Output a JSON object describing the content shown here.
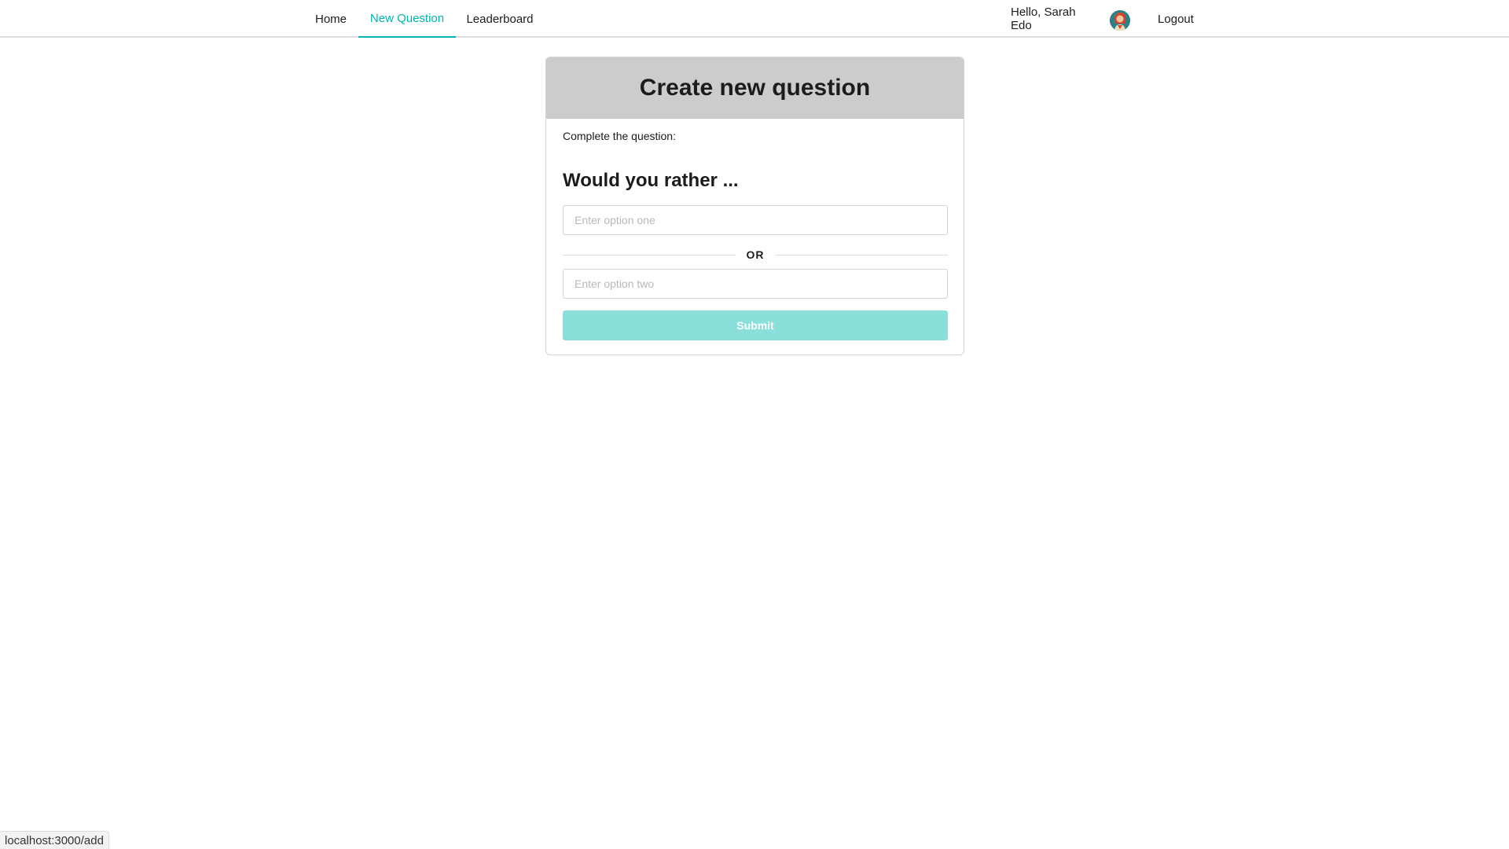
{
  "nav": {
    "home": "Home",
    "new_question": "New Question",
    "leaderboard": "Leaderboard",
    "greeting": "Hello, Sarah Edo",
    "logout": "Logout",
    "active_color": "#00b5ad"
  },
  "card": {
    "title": "Create new question",
    "prompt": "Complete the question:",
    "heading": "Would you rather ...",
    "option_one_placeholder": "Enter option one",
    "option_one_value": "",
    "divider": "OR",
    "option_two_placeholder": "Enter option two",
    "option_two_value": "",
    "submit": "Submit",
    "submit_color": "#8adfdb"
  },
  "status_bar": {
    "url": "localhost:3000/add"
  }
}
